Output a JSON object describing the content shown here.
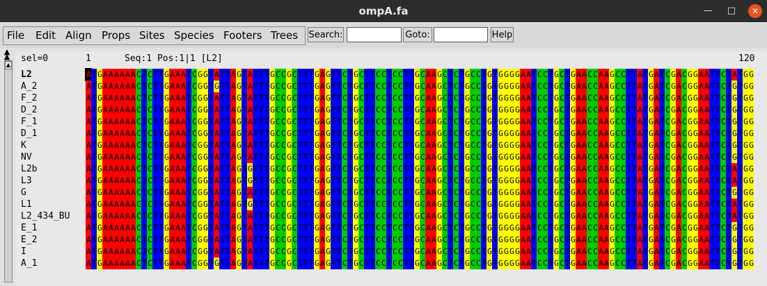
{
  "window": {
    "title": "ompA.fa"
  },
  "menu": [
    "File",
    "Edit",
    "Align",
    "Props",
    "Sites",
    "Species",
    "Footers",
    "Trees"
  ],
  "toolbar": {
    "search_label": "Search:",
    "search_value": "",
    "goto_label": "Goto:",
    "goto_value": "",
    "help_label": "Help"
  },
  "header": {
    "selection": "sel=0",
    "start": "1",
    "status": "Seq:1 Pos:1|1 [L2]",
    "end": "120"
  },
  "alignment": {
    "colors": {
      "A": "#ff0000",
      "C": "#00cc00",
      "G": "#ffff00",
      "T": "#0000ff"
    },
    "sequences": [
      {
        "name": "L2",
        "seq": "ATGAAAAAACTCTTGAAATCGGTATTAGTATTTGCCGCTTTGAGTTCTGCTTCCTCCTTGCAAGCTCTGCCTGTGGGGAATCCTGCTGAACCAAGCCTTATGATCGACGGAATTCTATGG"
      },
      {
        "name": "A_2",
        "seq": "ATGAAAAAACTCTTGAAATCGGTGTTAGTATTTGCCGCTTTGAGTTCTGCTTCCTCCTTGCAAGCTCTGCCTGTGGGGAATCCTGCTGAACCAAGCCTTATGATCGACGGAATTCTGTGG"
      },
      {
        "name": "F_2",
        "seq": "ATGAAAAAACTCTTGAAATCGGTATTAGTATTTGCCGCTTTGAGTTCTGCTTCCTCCTTGCAAGCTCTGCCTGTGGGGAATCCTGCTGAACCAAGCCTTATGATCGACGGAATTCTGTGG"
      },
      {
        "name": "D_2",
        "seq": "ATGAAAAAACTCTTGAAATCGGTATTAGTATTTGCCGCTTTGAGTTCTGCTTCCTCCTTGCAAGCTCTGCCTGTGGGGAATCCTGCTGAACCAAGCCTTATGATCGACGGAATTCTGTGG"
      },
      {
        "name": "F_1",
        "seq": "ATGAAAAAACTCTTGAAATCGGTATTAGTATTTGCCGCTTTGAGTTCTGCTTCCTCCTTGCAAGCTCTGCCTGTGGGGAATCCTGCTGAACCAAGCCTTATGATCGACGGAATTCTGTGG"
      },
      {
        "name": "D_1",
        "seq": "ATGAAAAAACTCTTGAAATCGGTATTAGTATTTGCCGCTTTGAGTTCTGCTTCCTCCTTGCAAGCTCTGCCTGTGGGGAATCCTGCTGAACCAAGCCTTATGATCGACGGAATTCTGTGG"
      },
      {
        "name": "K",
        "seq": "ATGAAAAAACTCTTGAAATCGGTATTAGTATTTGCCGCTTTGAGTTCTGCTTCCTCCTTGCAAGCTCTGCCTGTGGGGAATCCTGCTGAACCAAGCCTTATGATCGACGGAATTCTGTGG"
      },
      {
        "name": "NV",
        "seq": "ATGAAAAAACTCTTGAAATCGGTATTAGTATTTGCCGCTTTGAGTTCTGCTTCCTCCTTGCAAGCTCTGCCTGTGGGGAATCCTGCTGAACCAAGCCTTATGATCGACGGAATTCTGTGG"
      },
      {
        "name": "L2b",
        "seq": "ATGAAAAAACTCTTGAAATCGGTATTAGTGTTTGCCGCTTTGAGTTCTGCTTCCTCCTTGCAAGCTCTGCCTGTGGGGAATCCTGCTGAACCAAGCCTTATGATCGACGGAATTCTATGG"
      },
      {
        "name": "L3",
        "seq": "ATGAAAAAACTCTTGAAATCGGTATTAGTGTTTGCCGCTTTGAGTTCTGCTTCCTCCTTGCAAGCTCTGCCTGTGGGGAATCCTGCTGAACCAAGCCTTATGATCGACGGAATTCTATGG"
      },
      {
        "name": "G",
        "seq": "ATGAAAAAACTCTTGAAATCGGTATTAGTATTTGCCGCTTTGAGTTCTGCTTCCTCCTTGCAAGCTCTGCCTGTGGGGAATCCTGCTGAACCAAGCCTTATGATCGACGGAATTCTGTGG"
      },
      {
        "name": "L1",
        "seq": "ATGAAAAAACTCTTGAAATCGGTATTAGTGTTTGCCGCTTTGAGTTCTGCTTCCTCCTTGCAAGCTCTGCCTGTGGGGAATCCTGCTGAACCAAGCCTTATGATCGACGGAATTCTATGG"
      },
      {
        "name": "L2_434_BU",
        "seq": "ATGAAAAAACTCTTGAAATCGGTATTAGTATTTGCCGCTTTGAGTTCTGCTTCCTCCTTGCAAGCTCTGCCTGTGGGGAATCCTGCTGAACCAAGCCTTATGATCGACGGAATTCTATGG"
      },
      {
        "name": "E_1",
        "seq": "ATGAAAAAACTCTTGAAATCGGTATTAGTATTTGCCGCTTTGAGTTCTGCTTCCTCCTTGCAAGCTCTGCCTGTGGGGAATCCTGCTGAACCAAGCCTTATGATCGACGGAATTCTGTGG"
      },
      {
        "name": "E_2",
        "seq": "ATGAAAAAACTCTTGAAATCGGTATTAGTATTTGCCGCTTTGAGTTCTGCTTCCTCCTTGCAAGCTCTGCCTGTGGGGAATCCTGCTGAACCAAGCCTTATGATCGACGGAATTCTGTGG"
      },
      {
        "name": "I",
        "seq": "ATGAAAAAACTCTTGAAATCGGTATTAGTATTTGCCGCTTTGAGTTCTGCTTCCTCCTTGCAAGCTCTGCCTGTGGGGAATCCTGCTGAACCAAGCCTTATGATCGACGGAATTCTGTGG"
      },
      {
        "name": "A_1",
        "seq": "ATGAAAAAACTCTTGAAATCGGTGTTAGTATTTGCCGCTTTGAGTTCTGCTTCCTCCTTGCAAGCTCTGCCTGTGGGGAATCCTGCTGAACCAAGCCTTATGATCGACGGAATTCTGTGG"
      }
    ]
  }
}
